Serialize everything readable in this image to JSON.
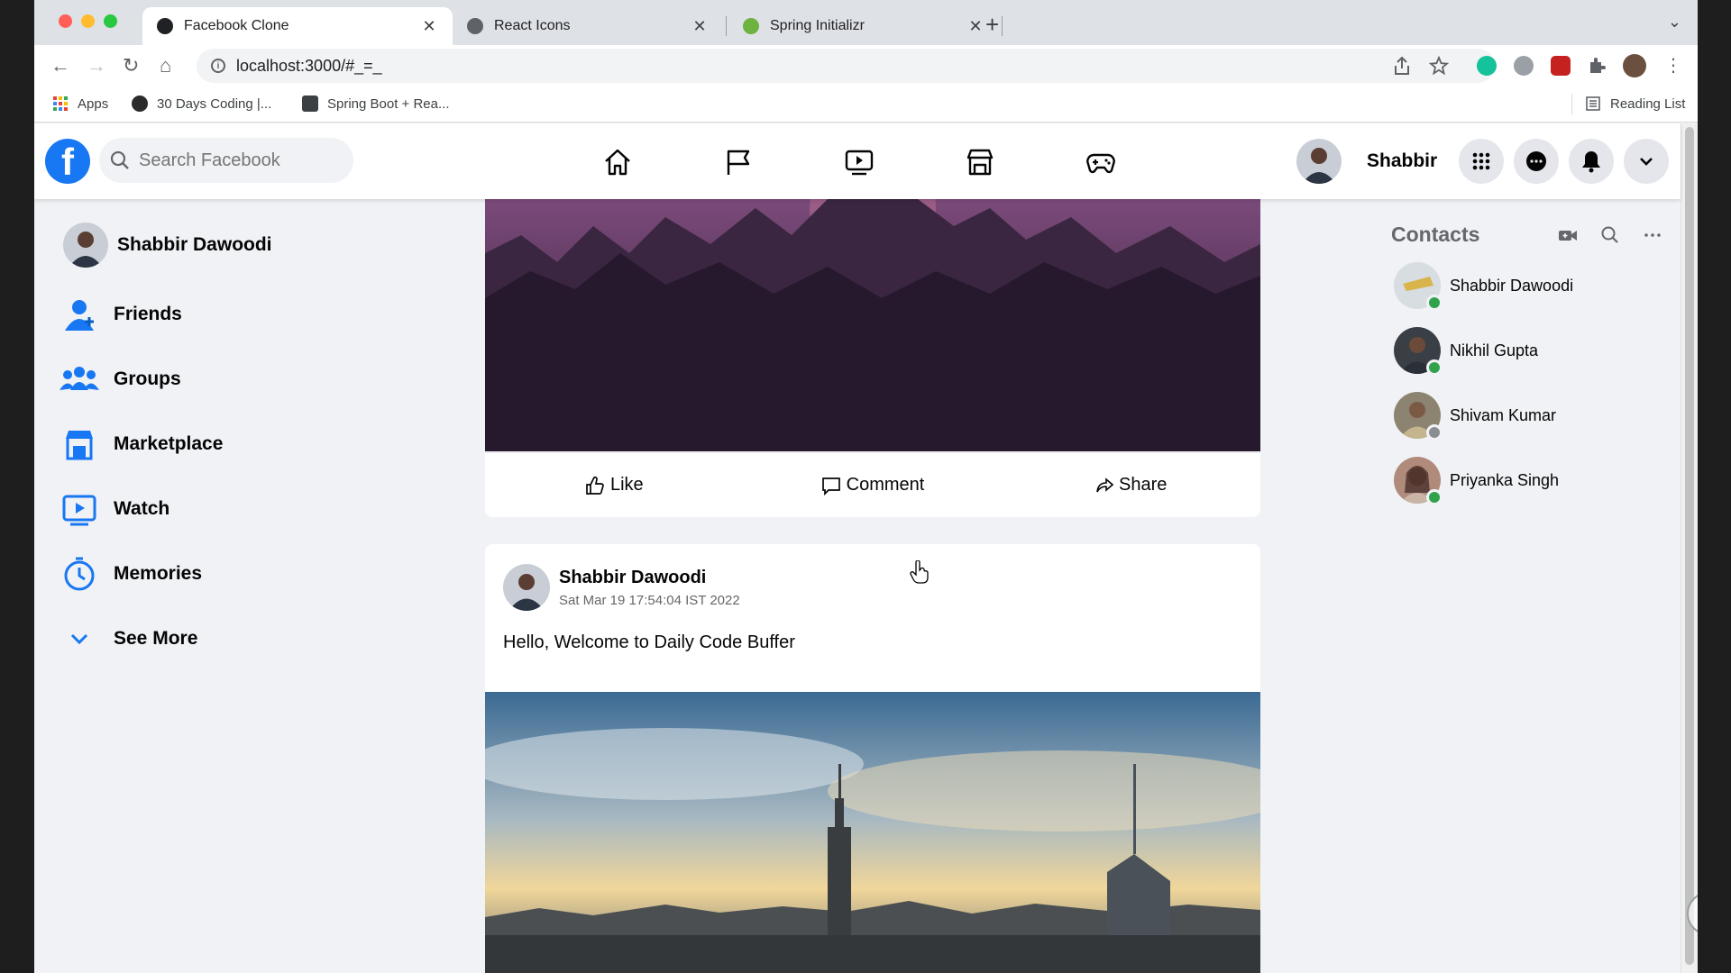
{
  "browser": {
    "tabs": [
      {
        "title": "Facebook Clone",
        "active": true
      },
      {
        "title": "React Icons",
        "active": false
      },
      {
        "title": "Spring Initializr",
        "active": false
      }
    ],
    "url": "localhost:3000/#_=_",
    "bookmarks": [
      {
        "label": "Apps"
      },
      {
        "label": "30 Days Coding |..."
      },
      {
        "label": "Spring Boot + Rea..."
      }
    ],
    "reading_list": "Reading List"
  },
  "header": {
    "search_placeholder": "Search Facebook",
    "user_name": "Shabbir",
    "brand_color": "#1877f2"
  },
  "sidebar": {
    "profile_name": "Shabbir Dawoodi",
    "items": [
      {
        "label": "Friends",
        "icon": "friends-icon"
      },
      {
        "label": "Groups",
        "icon": "groups-icon"
      },
      {
        "label": "Marketplace",
        "icon": "marketplace-icon"
      },
      {
        "label": "Watch",
        "icon": "watch-icon"
      },
      {
        "label": "Memories",
        "icon": "memories-icon"
      },
      {
        "label": "See More",
        "icon": "chevron-down-icon"
      }
    ]
  },
  "feed": {
    "actions": {
      "like": "Like",
      "comment": "Comment",
      "share": "Share"
    },
    "post2": {
      "author": "Shabbir Dawoodi",
      "timestamp": "Sat Mar 19 17:54:04 IST 2022",
      "text": "Hello, Welcome to Daily Code Buffer"
    }
  },
  "contacts": {
    "title": "Contacts",
    "list": [
      {
        "name": "Shabbir Dawoodi",
        "status": "online"
      },
      {
        "name": "Nikhil Gupta",
        "status": "online"
      },
      {
        "name": "Shivam Kumar",
        "status": "offline"
      },
      {
        "name": "Priyanka Singh",
        "status": "online"
      }
    ],
    "online_color": "#31a24c",
    "offline_color": "#8a8d91"
  }
}
